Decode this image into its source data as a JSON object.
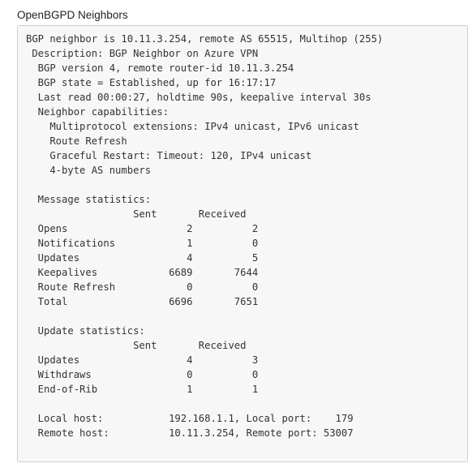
{
  "panel": {
    "title": "OpenBGPD Neighbors"
  },
  "output": {
    "lines": [
      "BGP neighbor is 10.11.3.254, remote AS 65515, Multihop (255)",
      " Description: BGP Neighbor on Azure VPN",
      "  BGP version 4, remote router-id 10.11.3.254",
      "  BGP state = Established, up for 16:17:17",
      "  Last read 00:00:27, holdtime 90s, keepalive interval 30s",
      "  Neighbor capabilities:",
      "    Multiprotocol extensions: IPv4 unicast, IPv6 unicast",
      "    Route Refresh",
      "    Graceful Restart: Timeout: 120, IPv4 unicast",
      "    4-byte AS numbers",
      "",
      "  Message statistics:",
      "                  Sent       Received",
      "  Opens                    2          2",
      "  Notifications            1          0",
      "  Updates                  4          5",
      "  Keepalives            6689       7644",
      "  Route Refresh            0          0",
      "  Total                 6696       7651",
      "",
      "  Update statistics:",
      "                  Sent       Received",
      "  Updates                  4          3",
      "  Withdraws                0          0",
      "  End-of-Rib               1          1",
      "",
      "  Local host:           192.168.1.1, Local port:    179",
      "  Remote host:          10.11.3.254, Remote port: 53007"
    ]
  },
  "colors": {
    "text": "#333333",
    "title": "#222222",
    "box_background": "#f7f7f7",
    "box_border": "#cfcfcf"
  }
}
